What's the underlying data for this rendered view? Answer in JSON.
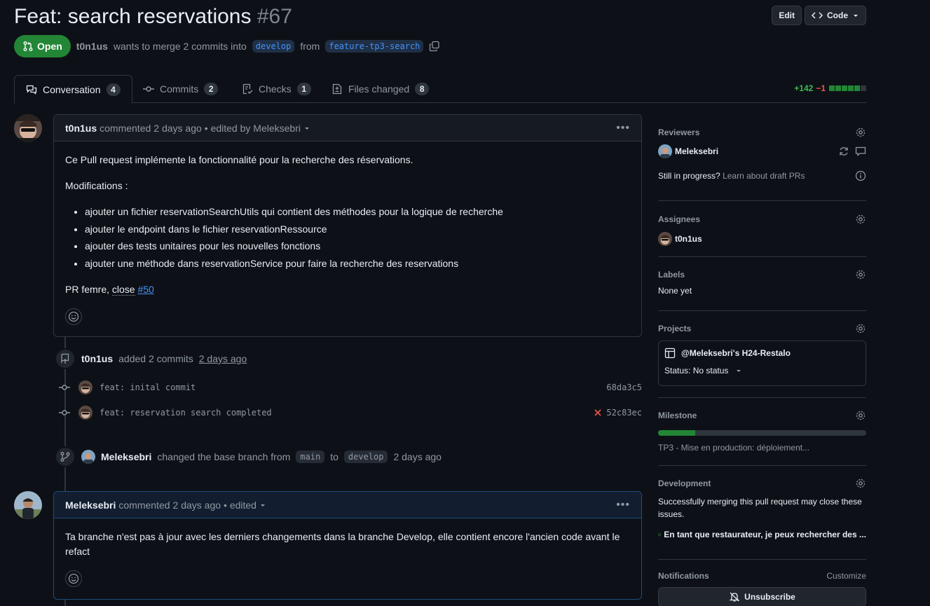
{
  "header": {
    "title": "Feat: search reservations",
    "number": "#67",
    "edit_label": "Edit",
    "code_label": "Code"
  },
  "meta": {
    "state": "Open",
    "author": "t0n1us",
    "text_before": "wants to merge 2 commits into",
    "base_branch": "develop",
    "text_from": "from",
    "head_branch": "feature-tp3-search"
  },
  "tabs": [
    {
      "label": "Conversation",
      "count": "4"
    },
    {
      "label": "Commits",
      "count": "2"
    },
    {
      "label": "Checks",
      "count": "1"
    },
    {
      "label": "Files changed",
      "count": "8"
    }
  ],
  "diffstat": {
    "additions": "+142",
    "deletions": "−1"
  },
  "comment1": {
    "author": "t0n1us",
    "action": "commented",
    "time": "2 days ago",
    "edited": "• edited by Meleksebri",
    "intro": "Ce Pull request implémente la fonctionnalité pour la recherche des réservations.",
    "mods_label": "Modifications :",
    "items": [
      "ajouter un fichier reservationSearchUtils qui contient des méthodes pour la logique de recherche",
      "ajouter le endpoint dans le fichier reservationRessource",
      "ajouter des tests unitaires pour les nouvelles fonctions",
      "ajouter une méthode dans reservationService pour faire la recherche des reservations"
    ],
    "closing_prefix": "PR femre,",
    "closing_word": "close",
    "issue_ref": "#50"
  },
  "commits_event": {
    "author": "t0n1us",
    "text": "added 2 commits",
    "time": "2 days ago",
    "commits": [
      {
        "message": "feat: inital commit",
        "sha": "68da3c5"
      },
      {
        "message": "feat: reservation search completed",
        "sha": "52c83ec"
      }
    ]
  },
  "base_event": {
    "author": "Meleksebri",
    "text": "changed the base branch from",
    "from": "main",
    "to_word": "to",
    "to": "develop",
    "time": "2 days ago"
  },
  "comment2": {
    "author": "Meleksebri",
    "action": "commented",
    "time": "2 days ago",
    "edited": "• edited",
    "body": "Ta branche n'est pas à jour avec les derniers changements dans la branche Develop, elle contient encore l'ancien code avant le refact"
  },
  "sidebar": {
    "reviewers_title": "Reviewers",
    "reviewer": "Meleksebri",
    "draft_q": "Still in progress?",
    "draft_link": "Learn about draft PRs",
    "assignees_title": "Assignees",
    "assignee": "t0n1us",
    "labels_title": "Labels",
    "labels_value": "None yet",
    "projects_title": "Projects",
    "project_name": "@Meleksebri's H24-Restalo",
    "project_status": "Status: No status",
    "milestone_title": "Milestone",
    "milestone_progress": 0.18,
    "milestone_name": "TP3 - Mise en production: déploiement...",
    "development_title": "Development",
    "development_text": "Successfully merging this pull request may close these issues.",
    "linked_issue": "En tant que restaurateur, je peux rechercher des ...",
    "notifications_title": "Notifications",
    "customize": "Customize",
    "unsubscribe": "Unsubscribe"
  },
  "colors": {
    "background": "#0d1117",
    "open_green": "#238636",
    "link_blue": "#4493f8",
    "danger_red": "#f85149"
  }
}
